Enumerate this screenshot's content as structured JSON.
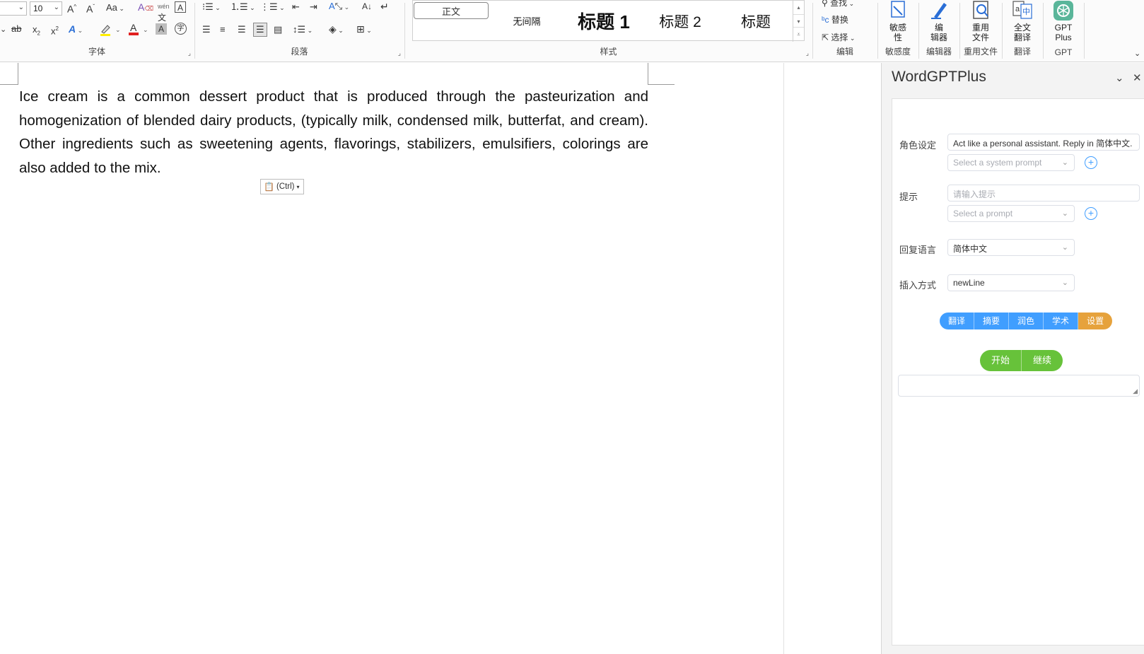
{
  "ribbon": {
    "font_group": {
      "label": "字体",
      "font_size": "10",
      "phonetic_glyph": "wén",
      "case_glyph": "Aa"
    },
    "paragraph_group": {
      "label": "段落"
    },
    "styles_group": {
      "label": "样式",
      "items": [
        {
          "label": "正文"
        },
        {
          "label": "无间隔"
        },
        {
          "label": "标题 1"
        },
        {
          "label": "标题 2"
        },
        {
          "label": "标题"
        }
      ]
    },
    "edit_group": {
      "label": "编辑",
      "find": "查找",
      "replace": "替换",
      "select": "选择"
    },
    "sensitivity_group": {
      "label": "敏感度",
      "button": "敏感性",
      "button2": "性"
    },
    "editor_group": {
      "label": "编辑器",
      "button_l1": "编",
      "button_l2": "辑器"
    },
    "reuse_group": {
      "label": "重用文件",
      "button_l1": "重用",
      "button_l2": "文件"
    },
    "translate_group": {
      "label": "翻译",
      "button_l1": "全文",
      "button_l2": "翻译"
    },
    "gpt_group": {
      "label": "GPT",
      "button_l1": "GPT",
      "button_l2": "Plus"
    }
  },
  "document": {
    "paragraph": "Ice cream is a common dessert product that is produced through the pasteurization and homogenization of blended dairy products, (typically milk, condensed milk, butterfat, and cream). Other ingredients such as sweetening agents, flavorings, stabilizers, emulsifiers, colorings are also added to the mix.",
    "paste_options": "(Ctrl)"
  },
  "pane": {
    "title": "WordGPTPlus",
    "role": {
      "label": "角色设定",
      "value": "Act like a personal assistant. Reply in 简体中文.",
      "system_prompt_placeholder": "Select a system prompt"
    },
    "prompt": {
      "label": "提示",
      "placeholder": "请输入提示",
      "select_placeholder": "Select a prompt"
    },
    "reply_language": {
      "label": "回复语言",
      "value": "简体中文"
    },
    "insert_mode": {
      "label": "插入方式",
      "value": "newLine"
    },
    "actions": [
      {
        "label": "翻译",
        "color": "#409eff"
      },
      {
        "label": "摘要",
        "color": "#409eff"
      },
      {
        "label": "润色",
        "color": "#409eff"
      },
      {
        "label": "学术",
        "color": "#409eff"
      },
      {
        "label": "设置",
        "color": "#e6a23c"
      }
    ],
    "run": [
      {
        "label": "开始",
        "color": "#67c23a"
      },
      {
        "label": "继续",
        "color": "#67c23a"
      }
    ]
  }
}
